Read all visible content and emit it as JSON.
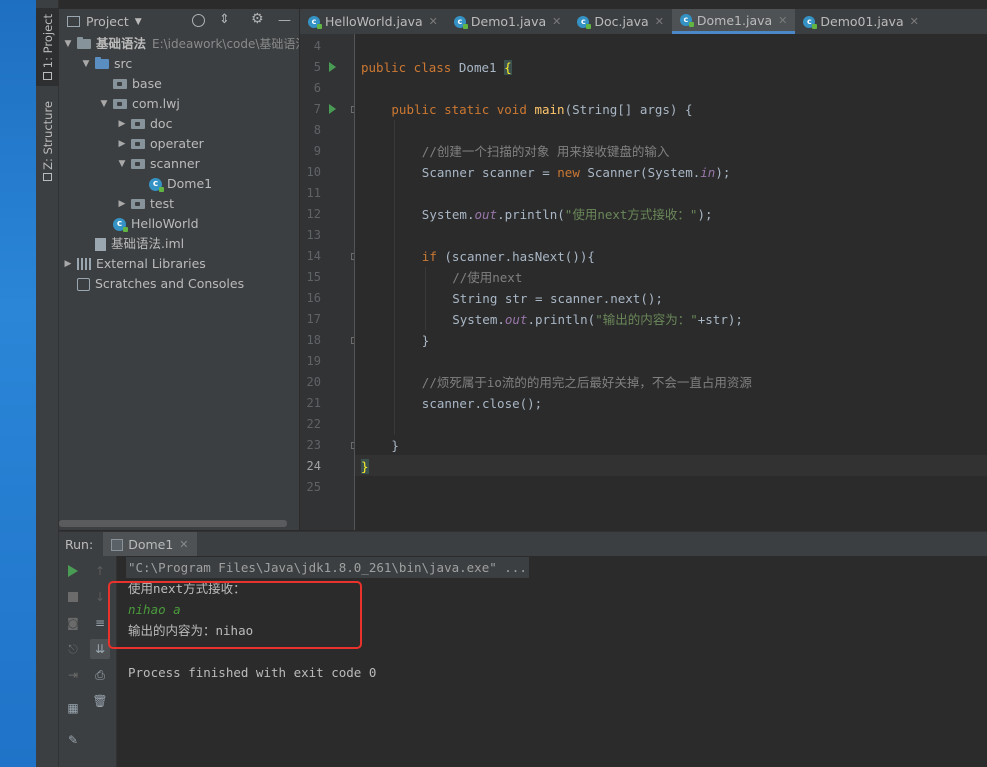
{
  "sidebar": {
    "project_tab": "1: Project",
    "structure_tab": "Z: Structure"
  },
  "project_panel": {
    "title": "Project",
    "tree": [
      {
        "label": "基础语法",
        "hint": "E:\\ideawork\\code\\基础语法",
        "kind": "module",
        "arrow": "▼"
      },
      {
        "label": "src",
        "kind": "folder-src",
        "arrow": "▼"
      },
      {
        "label": "base",
        "kind": "package",
        "arrow": ""
      },
      {
        "label": "com.lwj",
        "kind": "package",
        "arrow": "▼"
      },
      {
        "label": "doc",
        "kind": "package",
        "arrow": "▶"
      },
      {
        "label": "operater",
        "kind": "package",
        "arrow": "▶"
      },
      {
        "label": "scanner",
        "kind": "package",
        "arrow": "▼"
      },
      {
        "label": "Dome1",
        "kind": "class",
        "arrow": ""
      },
      {
        "label": "test",
        "kind": "package",
        "arrow": "▶"
      },
      {
        "label": "HelloWorld",
        "kind": "class",
        "arrow": ""
      },
      {
        "label": "基础语法.iml",
        "kind": "iml",
        "arrow": ""
      },
      {
        "label": "External Libraries",
        "kind": "libs",
        "arrow": "▶"
      },
      {
        "label": "Scratches and Consoles",
        "kind": "scratch",
        "arrow": ""
      }
    ]
  },
  "editor_tabs": [
    {
      "label": "HelloWorld.java",
      "active": false
    },
    {
      "label": "Demo1.java",
      "active": false
    },
    {
      "label": "Doc.java",
      "active": false
    },
    {
      "label": "Dome1.java",
      "active": true
    },
    {
      "label": "Demo01.java",
      "active": false
    }
  ],
  "code_lines": [
    {
      "n": "4"
    },
    {
      "n": "5",
      "run": true
    },
    {
      "n": "6"
    },
    {
      "n": "7",
      "run": true,
      "fold": true
    },
    {
      "n": "8"
    },
    {
      "n": "9"
    },
    {
      "n": "10"
    },
    {
      "n": "11"
    },
    {
      "n": "12"
    },
    {
      "n": "13"
    },
    {
      "n": "14",
      "fold": true
    },
    {
      "n": "15"
    },
    {
      "n": "16"
    },
    {
      "n": "17"
    },
    {
      "n": "18",
      "fold": true
    },
    {
      "n": "19"
    },
    {
      "n": "20"
    },
    {
      "n": "21"
    },
    {
      "n": "22"
    },
    {
      "n": "23",
      "fold": true
    },
    {
      "n": "24",
      "current": true
    },
    {
      "n": "25"
    }
  ],
  "code": {
    "l5": {
      "kw": "public class",
      "name": "Dome1",
      "brace": "{"
    },
    "l7": {
      "kw": "public static void",
      "fn": "main",
      "rest": "(String[] args) {"
    },
    "l9": "//创建一个扫描的对象 用来接收键盘的输入",
    "l10": {
      "a": "Scanner scanner = ",
      "kw": "new",
      "b": " Scanner(System.",
      "fld": "in",
      "c": ");"
    },
    "l12": {
      "a": "System.",
      "fld": "out",
      "b": ".println(",
      "str": "\"使用next方式接收：\"",
      "c": ");"
    },
    "l14": {
      "kw": "if",
      "rest": " (scanner.hasNext()){"
    },
    "l15": "//使用next",
    "l16": "String str = scanner.next();",
    "l17": {
      "a": "System.",
      "fld": "out",
      "b": ".println(",
      "str": "\"输出的内容为：\"",
      "c": "+str);"
    },
    "l18": "}",
    "l20": "//烦死属于io流的的用完之后最好关掉，不会一直占用资源",
    "l21": "scanner.close();",
    "l23": "}",
    "l24": "}"
  },
  "run_panel": {
    "label": "Run:",
    "tab": "Dome1",
    "console": {
      "command": "\"C:\\Program Files\\Java\\jdk1.8.0_261\\bin\\java.exe\" ...",
      "prompt": "使用next方式接收：",
      "user_input": "nihao a",
      "output": "输出的内容为：nihao",
      "exit": "Process finished with exit code 0"
    }
  },
  "colors": {
    "keyword": "#cc7832",
    "string": "#6a8759",
    "comment": "#808080",
    "field": "#9876aa",
    "method": "#ffc66d",
    "input_green": "#62b543",
    "highlight_box": "#e8322b"
  }
}
